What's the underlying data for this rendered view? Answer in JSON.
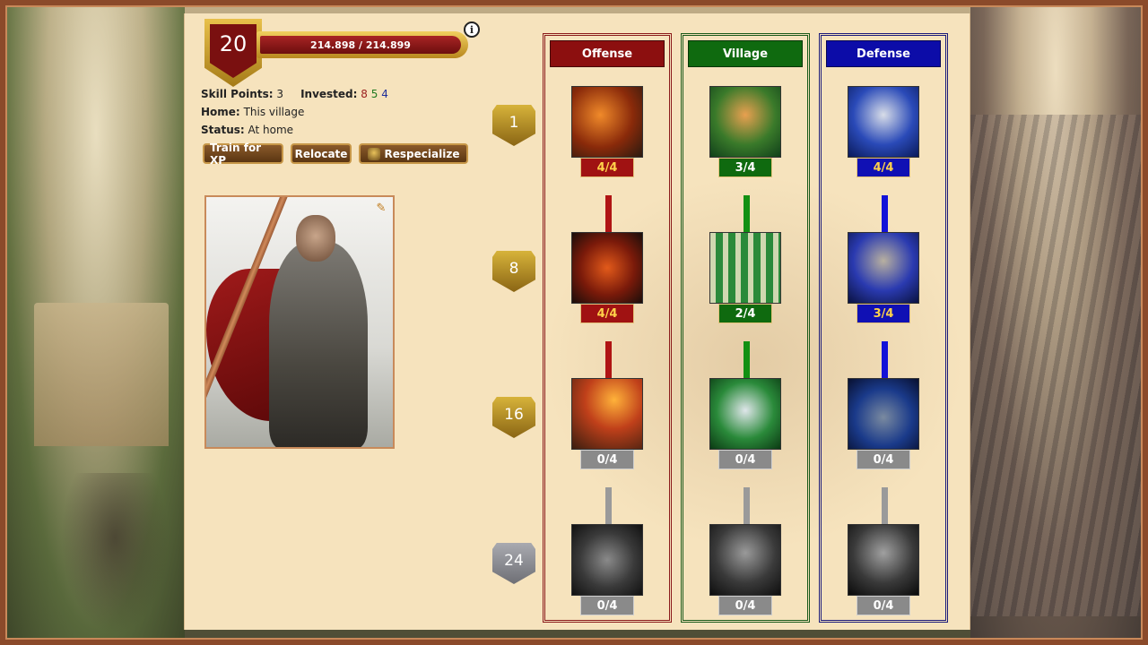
{
  "hero": {
    "level": "20",
    "xp_text": "214.898 / 214.899",
    "skill_points_label": "Skill Points:",
    "skill_points_value": "3",
    "invested_label": "Invested:",
    "invested_offense": "8",
    "invested_village": "5",
    "invested_defense": "4",
    "home_label": "Home:",
    "home_value": "This village",
    "status_label": "Status:",
    "status_value": "At home"
  },
  "buttons": {
    "train": "Train for XP",
    "relocate": "Relocate",
    "respecialize": "Respecialize"
  },
  "icons": {
    "info": "i",
    "edit": "✎"
  },
  "tiers": [
    "1",
    "8",
    "16",
    "24"
  ],
  "columns": {
    "offense": {
      "title": "Offense",
      "color": "#8c0f0f",
      "skills": [
        {
          "name": "axe-warrior-icon",
          "count": "4/4"
        },
        {
          "name": "mounted-knight-icon",
          "count": "4/4"
        },
        {
          "name": "catapult-fire-icon",
          "count": "0/4"
        },
        {
          "name": "siege-ram-icon",
          "count": "0/4"
        }
      ]
    },
    "village": {
      "title": "Village",
      "color": "#0f6a0f",
      "skills": [
        {
          "name": "resource-cart-icon",
          "count": "3/4"
        },
        {
          "name": "scaffolding-icon",
          "count": "2/4"
        },
        {
          "name": "archer-icon",
          "count": "0/4"
        },
        {
          "name": "merchant-icon",
          "count": "0/4"
        }
      ]
    },
    "defense": {
      "title": "Defense",
      "color": "#0c0ca8",
      "skills": [
        {
          "name": "shield-knight-icon",
          "count": "4/4"
        },
        {
          "name": "spearman-icon",
          "count": "3/4"
        },
        {
          "name": "fortress-icon",
          "count": "0/4"
        },
        {
          "name": "boiling-oil-icon",
          "count": "0/4"
        }
      ]
    }
  }
}
